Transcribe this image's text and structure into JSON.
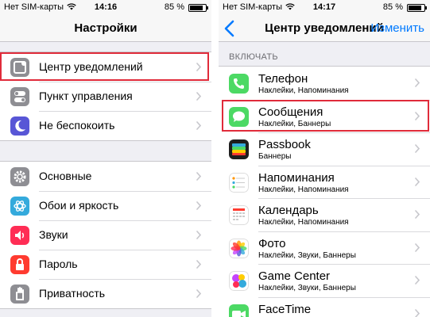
{
  "left_screen": {
    "status": {
      "carrier": "Нет SIM-карты",
      "time": "14:16",
      "battery": "85 %",
      "battery_level": 0.85
    },
    "title": "Настройки",
    "group1": [
      {
        "label": "Центр уведомлений",
        "icon": "notification-center-icon",
        "color": "#8e8e93"
      },
      {
        "label": "Пункт управления",
        "icon": "control-center-icon",
        "color": "#8e8e93"
      },
      {
        "label": "Не беспокоить",
        "icon": "moon-icon",
        "color": "#5856d6"
      }
    ],
    "group2": [
      {
        "label": "Основные",
        "icon": "gear-icon",
        "color": "#8e8e93"
      },
      {
        "label": "Обои и яркость",
        "icon": "wallpaper-icon",
        "color": "#34aadc"
      },
      {
        "label": "Звуки",
        "icon": "speaker-icon",
        "color": "#ff2d55"
      },
      {
        "label": "Пароль",
        "icon": "lock-icon",
        "color": "#ff3b30"
      },
      {
        "label": "Приватность",
        "icon": "hand-icon",
        "color": "#8e8e93"
      }
    ]
  },
  "right_screen": {
    "status": {
      "carrier": "Нет SIM-карты",
      "time": "14:17",
      "battery": "85 %",
      "battery_level": 0.85
    },
    "title": "Центр уведомлений",
    "edit_label": "Изменить",
    "section_header": "ВКЛЮЧАТЬ",
    "apps": [
      {
        "label": "Телефон",
        "sub": "Наклейки, Напоминания",
        "icon": "phone-icon",
        "color": "#4cd964"
      },
      {
        "label": "Сообщения",
        "sub": "Наклейки, Баннеры",
        "icon": "messages-icon",
        "color": "#4cd964"
      },
      {
        "label": "Passbook",
        "sub": "Баннеры",
        "icon": "passbook-icon",
        "color": "#1e1e1e"
      },
      {
        "label": "Напоминания",
        "sub": "Наклейки, Напоминания",
        "icon": "reminders-icon",
        "color": "#ffffff"
      },
      {
        "label": "Календарь",
        "sub": "Наклейки, Напоминания",
        "icon": "calendar-icon",
        "color": "#ffffff"
      },
      {
        "label": "Фото",
        "sub": "Наклейки, Звуки, Баннеры",
        "icon": "photos-icon",
        "color": "#ffffff"
      },
      {
        "label": "Game Center",
        "sub": "Наклейки, Звуки, Баннеры",
        "icon": "game-center-icon",
        "color": "#ffffff"
      },
      {
        "label": "FaceTime",
        "sub": "",
        "icon": "facetime-icon",
        "color": "#4cd964"
      }
    ]
  },
  "highlight_color": "#e02b3a"
}
